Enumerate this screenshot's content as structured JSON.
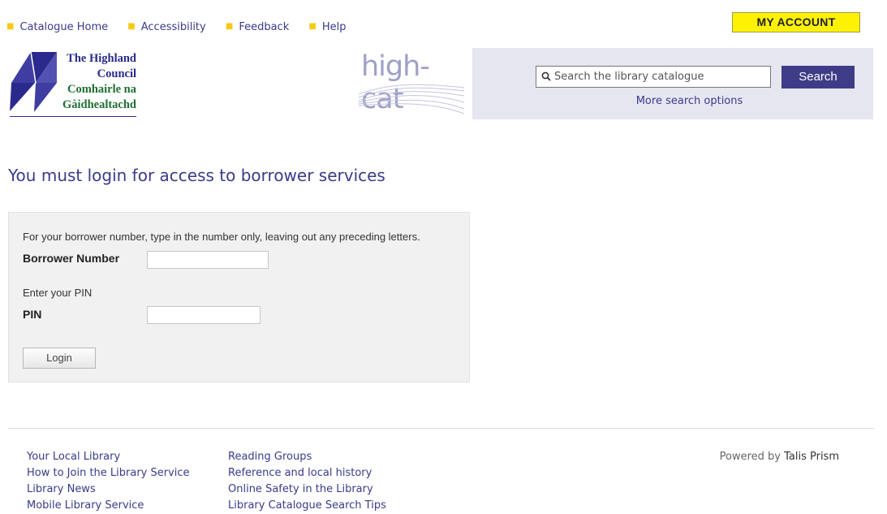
{
  "topnav": {
    "items": [
      {
        "label": "Catalogue Home"
      },
      {
        "label": "Accessibility"
      },
      {
        "label": "Feedback"
      },
      {
        "label": "Help"
      }
    ]
  },
  "account": {
    "label": "MY ACCOUNT"
  },
  "logo": {
    "lines": [
      "The Highland",
      "Council",
      "Comhairle na",
      "Gàidhealtachd"
    ],
    "color_blue": "#2a2a8c",
    "color_green": "#1f6e33"
  },
  "brand": {
    "name": "high-cat"
  },
  "search": {
    "placeholder": "Search the library catalogue",
    "button_label": "Search",
    "more_options": "More search options"
  },
  "page": {
    "heading": "You must login for access to borrower services"
  },
  "login": {
    "hint": "For your borrower number, type in the number only, leaving out any preceding letters.",
    "borrower_label": "Borrower Number",
    "borrower_value": "",
    "pin_hint": "Enter your PIN",
    "pin_label": "PIN",
    "pin_value": "",
    "button_label": "Login"
  },
  "footer": {
    "col1": [
      "Your Local Library",
      "How to Join the Library Service",
      "Library News",
      "Mobile Library Service"
    ],
    "col2": [
      "Reading Groups",
      "Reference and local history",
      "Online Safety in the Library",
      "Library Catalogue Search Tips"
    ],
    "powered_by": "Powered by",
    "powered_link": "Talis Prism"
  },
  "colors": {
    "accent": "#3f3c87",
    "link": "#3a3a8c",
    "account_bg": "#fff200",
    "bullet": "#f2cc17",
    "search_panel_bg": "#e6e6f1",
    "login_panel_bg": "#f1f1f1"
  }
}
